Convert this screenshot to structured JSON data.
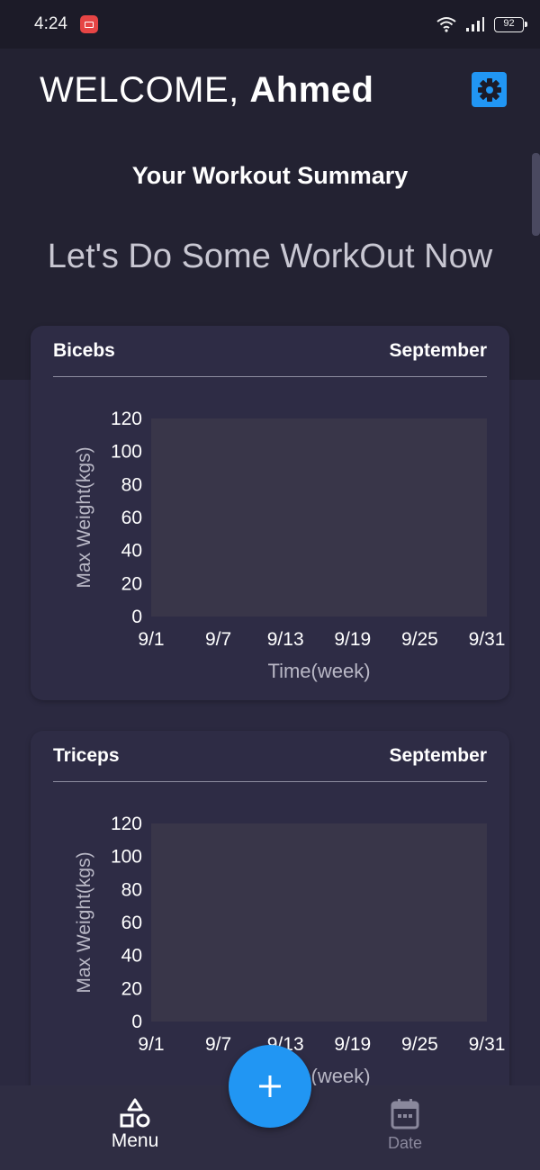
{
  "status_bar": {
    "time": "4:24",
    "battery": "92",
    "icons": [
      "screen-record-icon",
      "wifi-icon",
      "signal-icon",
      "battery-icon"
    ]
  },
  "header": {
    "greeting": "WELCOME, ",
    "user_name": "Ahmed",
    "settings_icon": "gear-icon",
    "summary_title": "Your Workout Summary",
    "tagline": "Let's Do Some WorkOut Now"
  },
  "cards": [
    {
      "title": "Bicebs",
      "month": "September"
    },
    {
      "title": "Triceps",
      "month": "September"
    }
  ],
  "chart_data": [
    {
      "type": "line",
      "x": [
        "9/1",
        "9/7",
        "9/13",
        "9/19",
        "9/25",
        "9/31"
      ],
      "yticks": [
        "0",
        "20",
        "40",
        "60",
        "80",
        "100",
        "120"
      ],
      "series": [],
      "xlabel": "Time(week)",
      "ylabel": "Max Weight(kgs)",
      "ylim": [
        0,
        120
      ],
      "grid": false
    },
    {
      "type": "line",
      "x": [
        "9/1",
        "9/7",
        "9/13",
        "9/19",
        "9/25",
        "9/31"
      ],
      "yticks": [
        "0",
        "20",
        "40",
        "60",
        "80",
        "100",
        "120"
      ],
      "series": [],
      "xlabel": "Time(week)",
      "ylabel": "Max Weight(kgs)",
      "ylim": [
        0,
        120
      ],
      "grid": false
    }
  ],
  "nav": {
    "menu_label": "Menu",
    "date_label": "Date",
    "add_icon": "plus-icon"
  },
  "colors": {
    "accent": "#2196f3",
    "background": "#2b2940",
    "card": "#2e2c45",
    "plot_area": "#393649"
  }
}
